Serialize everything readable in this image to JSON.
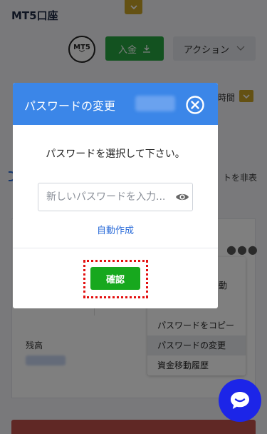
{
  "header": {
    "title": "MT5口座",
    "badge_label": "MT5",
    "deposit_label": "入金",
    "action_label": "アクション"
  },
  "background": {
    "time_label": "時間",
    "hide_text": "トを非表",
    "balance_label": "残高"
  },
  "context_menu": {
    "items": [
      "移動",
      "",
      "パスワードをコピー",
      "パスワードの変更",
      "資金移動履歴"
    ],
    "active_item": "パスワードの変更"
  },
  "modal": {
    "title": "パスワードの変更",
    "instruction": "パスワードを選択して下さい。",
    "password_placeholder": "新しいパスワードを入力...",
    "auto_generate_label": "自動作成",
    "confirm_label": "確認"
  },
  "icons": {
    "close": "close-circle-icon",
    "eye": "eye-icon",
    "chat": "chat-icon",
    "download": "download-icon",
    "chevron": "chevron-down-icon"
  },
  "colors": {
    "primary_blue": "#3b86e8",
    "confirm_green": "#17a81e",
    "deposit_green": "#26a541",
    "highlight_red": "#e31010",
    "gold": "#c9a227",
    "chat_blue": "#1c25e8"
  }
}
